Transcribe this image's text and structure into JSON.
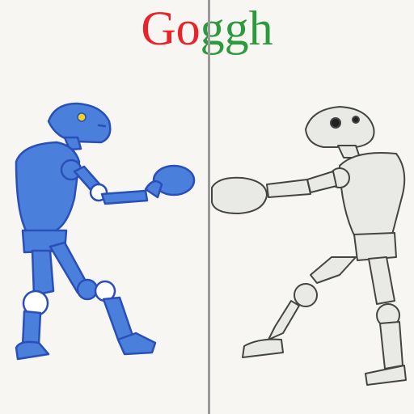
{
  "logo": {
    "letters": [
      {
        "char": "G",
        "color": "#e8242a"
      },
      {
        "char": "o",
        "color": "#e8242a"
      },
      {
        "char": "g",
        "color": "#2e9a3e"
      },
      {
        "char": "g",
        "color": "#2e9a3e"
      },
      {
        "char": "h",
        "color": "#2e9a3e"
      }
    ]
  },
  "left_robot": {
    "fill": "#4a7fdc",
    "stroke": "#2a4fb8"
  },
  "right_robot": {
    "fill": "#e9e9e6",
    "stroke": "#444444"
  }
}
